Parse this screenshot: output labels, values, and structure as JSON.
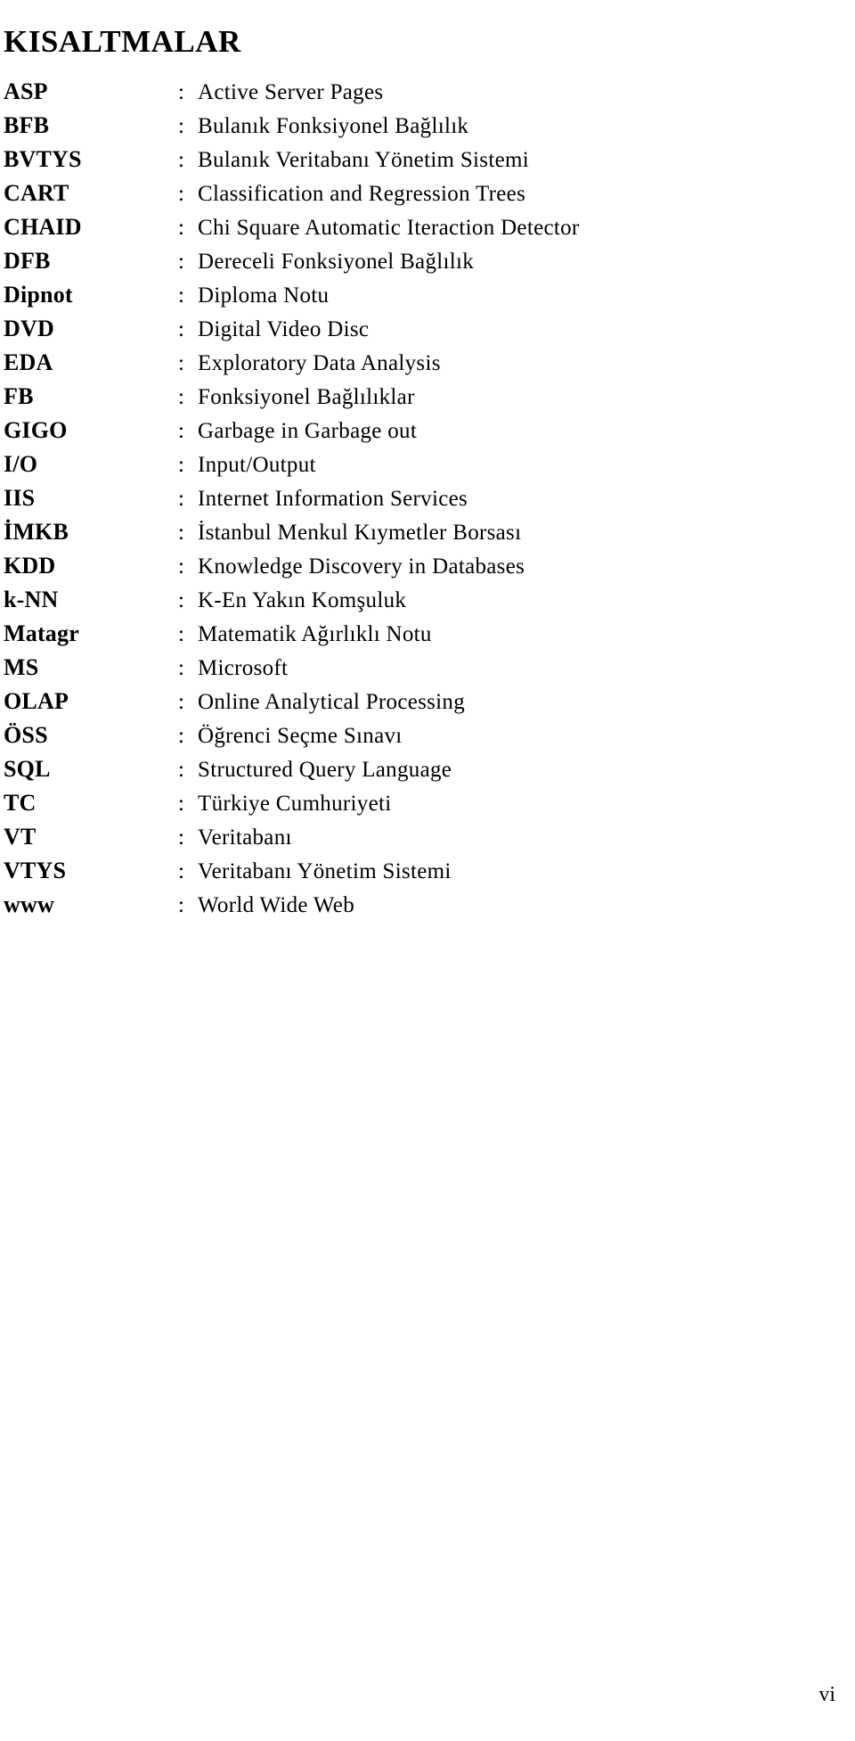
{
  "document": {
    "title": "KISALTMALAR",
    "separator": ":",
    "page_number": "vi"
  },
  "abbreviations": [
    {
      "term": "ASP",
      "definition": "Active Server Pages"
    },
    {
      "term": "BFB",
      "definition": "Bulanık Fonksiyonel Bağlılık"
    },
    {
      "term": "BVTYS",
      "definition": "Bulanık Veritabanı Yönetim Sistemi"
    },
    {
      "term": "CART",
      "definition": "Classification and Regression Trees"
    },
    {
      "term": "CHAID",
      "definition": "Chi Square Automatic Iteraction Detector"
    },
    {
      "term": "DFB",
      "definition": "Dereceli Fonksiyonel Bağlılık"
    },
    {
      "term": "Dipnot",
      "definition": "Diploma Notu"
    },
    {
      "term": "DVD",
      "definition": "Digital Video Disc"
    },
    {
      "term": "EDA",
      "definition": "Exploratory Data Analysis"
    },
    {
      "term": "FB",
      "definition": "Fonksiyonel Bağlılıklar"
    },
    {
      "term": "GIGO",
      "definition": "Garbage in Garbage out"
    },
    {
      "term": "I/O",
      "definition": "Input/Output"
    },
    {
      "term": "IIS",
      "definition": "Internet Information Services"
    },
    {
      "term": "İMKB",
      "definition": "İstanbul Menkul Kıymetler Borsası"
    },
    {
      "term": "KDD",
      "definition": "Knowledge Discovery in Databases"
    },
    {
      "term": "k-NN",
      "definition": "K-En Yakın Komşuluk"
    },
    {
      "term": "Matagr",
      "definition": "Matematik Ağırlıklı Notu"
    },
    {
      "term": "MS",
      "definition": "Microsoft"
    },
    {
      "term": "OLAP",
      "definition": "Online Analytical Processing"
    },
    {
      "term": "ÖSS",
      "definition": "Öğrenci Seçme Sınavı"
    },
    {
      "term": "SQL",
      "definition": "Structured Query Language"
    },
    {
      "term": "TC",
      "definition": "Türkiye Cumhuriyeti"
    },
    {
      "term": "VT",
      "definition": "Veritabanı"
    },
    {
      "term": "VTYS",
      "definition": "Veritabanı Yönetim Sistemi"
    },
    {
      "term": "www",
      "definition": "World Wide Web"
    }
  ]
}
